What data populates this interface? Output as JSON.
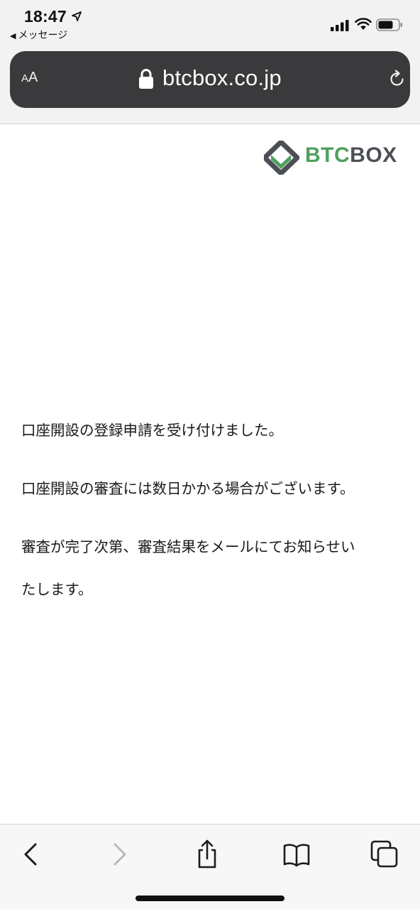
{
  "status_bar": {
    "time": "18:47",
    "back_app": "メッセージ",
    "icons": [
      "location-arrow-icon",
      "cellular-signal-icon",
      "wifi-icon",
      "battery-icon"
    ]
  },
  "address_bar": {
    "text_size_button": {
      "small": "A",
      "big": "A"
    },
    "url": "btcbox.co.jp",
    "icons": [
      "lock-icon",
      "reload-icon"
    ]
  },
  "page": {
    "logo": {
      "btc": "BTC",
      "box": "BOX",
      "colors": {
        "btc": "#4ea05e",
        "box": "#4c4f55"
      }
    },
    "messages": [
      "口座開設の登録申請を受け付けました。",
      "口座開設の審査には数日かかる場合がございます。",
      "審査が完了次第、審査結果をメールにてお知らせい",
      "たします。"
    ]
  },
  "toolbar": {
    "icons": [
      "back-icon",
      "forward-icon",
      "share-icon",
      "bookmarks-icon",
      "tabs-icon"
    ]
  },
  "colors": {
    "address_bar_bg": "#3a3a3c",
    "chrome_bg": "#f2f2f3",
    "toolbar_icon": "#1c1c1e",
    "toolbar_icon_disabled": "#b8b8bc"
  }
}
